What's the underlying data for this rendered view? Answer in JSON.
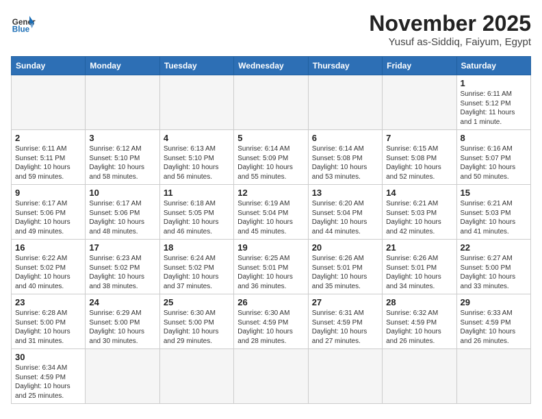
{
  "header": {
    "logo_general": "General",
    "logo_blue": "Blue",
    "month_title": "November 2025",
    "location": "Yusuf as-Siddiq, Faiyum, Egypt"
  },
  "weekdays": [
    "Sunday",
    "Monday",
    "Tuesday",
    "Wednesday",
    "Thursday",
    "Friday",
    "Saturday"
  ],
  "days": [
    {
      "num": "",
      "info": "",
      "empty": true
    },
    {
      "num": "",
      "info": "",
      "empty": true
    },
    {
      "num": "",
      "info": "",
      "empty": true
    },
    {
      "num": "",
      "info": "",
      "empty": true
    },
    {
      "num": "",
      "info": "",
      "empty": true
    },
    {
      "num": "",
      "info": "",
      "empty": true
    },
    {
      "num": "1",
      "info": "Sunrise: 6:11 AM\nSunset: 5:12 PM\nDaylight: 11 hours\nand 1 minute.",
      "empty": false
    },
    {
      "num": "2",
      "info": "Sunrise: 6:11 AM\nSunset: 5:11 PM\nDaylight: 10 hours\nand 59 minutes.",
      "empty": false
    },
    {
      "num": "3",
      "info": "Sunrise: 6:12 AM\nSunset: 5:10 PM\nDaylight: 10 hours\nand 58 minutes.",
      "empty": false
    },
    {
      "num": "4",
      "info": "Sunrise: 6:13 AM\nSunset: 5:10 PM\nDaylight: 10 hours\nand 56 minutes.",
      "empty": false
    },
    {
      "num": "5",
      "info": "Sunrise: 6:14 AM\nSunset: 5:09 PM\nDaylight: 10 hours\nand 55 minutes.",
      "empty": false
    },
    {
      "num": "6",
      "info": "Sunrise: 6:14 AM\nSunset: 5:08 PM\nDaylight: 10 hours\nand 53 minutes.",
      "empty": false
    },
    {
      "num": "7",
      "info": "Sunrise: 6:15 AM\nSunset: 5:08 PM\nDaylight: 10 hours\nand 52 minutes.",
      "empty": false
    },
    {
      "num": "8",
      "info": "Sunrise: 6:16 AM\nSunset: 5:07 PM\nDaylight: 10 hours\nand 50 minutes.",
      "empty": false
    },
    {
      "num": "9",
      "info": "Sunrise: 6:17 AM\nSunset: 5:06 PM\nDaylight: 10 hours\nand 49 minutes.",
      "empty": false
    },
    {
      "num": "10",
      "info": "Sunrise: 6:17 AM\nSunset: 5:06 PM\nDaylight: 10 hours\nand 48 minutes.",
      "empty": false
    },
    {
      "num": "11",
      "info": "Sunrise: 6:18 AM\nSunset: 5:05 PM\nDaylight: 10 hours\nand 46 minutes.",
      "empty": false
    },
    {
      "num": "12",
      "info": "Sunrise: 6:19 AM\nSunset: 5:04 PM\nDaylight: 10 hours\nand 45 minutes.",
      "empty": false
    },
    {
      "num": "13",
      "info": "Sunrise: 6:20 AM\nSunset: 5:04 PM\nDaylight: 10 hours\nand 44 minutes.",
      "empty": false
    },
    {
      "num": "14",
      "info": "Sunrise: 6:21 AM\nSunset: 5:03 PM\nDaylight: 10 hours\nand 42 minutes.",
      "empty": false
    },
    {
      "num": "15",
      "info": "Sunrise: 6:21 AM\nSunset: 5:03 PM\nDaylight: 10 hours\nand 41 minutes.",
      "empty": false
    },
    {
      "num": "16",
      "info": "Sunrise: 6:22 AM\nSunset: 5:02 PM\nDaylight: 10 hours\nand 40 minutes.",
      "empty": false
    },
    {
      "num": "17",
      "info": "Sunrise: 6:23 AM\nSunset: 5:02 PM\nDaylight: 10 hours\nand 38 minutes.",
      "empty": false
    },
    {
      "num": "18",
      "info": "Sunrise: 6:24 AM\nSunset: 5:02 PM\nDaylight: 10 hours\nand 37 minutes.",
      "empty": false
    },
    {
      "num": "19",
      "info": "Sunrise: 6:25 AM\nSunset: 5:01 PM\nDaylight: 10 hours\nand 36 minutes.",
      "empty": false
    },
    {
      "num": "20",
      "info": "Sunrise: 6:26 AM\nSunset: 5:01 PM\nDaylight: 10 hours\nand 35 minutes.",
      "empty": false
    },
    {
      "num": "21",
      "info": "Sunrise: 6:26 AM\nSunset: 5:01 PM\nDaylight: 10 hours\nand 34 minutes.",
      "empty": false
    },
    {
      "num": "22",
      "info": "Sunrise: 6:27 AM\nSunset: 5:00 PM\nDaylight: 10 hours\nand 33 minutes.",
      "empty": false
    },
    {
      "num": "23",
      "info": "Sunrise: 6:28 AM\nSunset: 5:00 PM\nDaylight: 10 hours\nand 31 minutes.",
      "empty": false
    },
    {
      "num": "24",
      "info": "Sunrise: 6:29 AM\nSunset: 5:00 PM\nDaylight: 10 hours\nand 30 minutes.",
      "empty": false
    },
    {
      "num": "25",
      "info": "Sunrise: 6:30 AM\nSunset: 5:00 PM\nDaylight: 10 hours\nand 29 minutes.",
      "empty": false
    },
    {
      "num": "26",
      "info": "Sunrise: 6:30 AM\nSunset: 4:59 PM\nDaylight: 10 hours\nand 28 minutes.",
      "empty": false
    },
    {
      "num": "27",
      "info": "Sunrise: 6:31 AM\nSunset: 4:59 PM\nDaylight: 10 hours\nand 27 minutes.",
      "empty": false
    },
    {
      "num": "28",
      "info": "Sunrise: 6:32 AM\nSunset: 4:59 PM\nDaylight: 10 hours\nand 26 minutes.",
      "empty": false
    },
    {
      "num": "29",
      "info": "Sunrise: 6:33 AM\nSunset: 4:59 PM\nDaylight: 10 hours\nand 26 minutes.",
      "empty": false
    },
    {
      "num": "30",
      "info": "Sunrise: 6:34 AM\nSunset: 4:59 PM\nDaylight: 10 hours\nand 25 minutes.",
      "empty": false
    },
    {
      "num": "",
      "info": "",
      "empty": true
    },
    {
      "num": "",
      "info": "",
      "empty": true
    },
    {
      "num": "",
      "info": "",
      "empty": true
    },
    {
      "num": "",
      "info": "",
      "empty": true
    },
    {
      "num": "",
      "info": "",
      "empty": true
    },
    {
      "num": "",
      "info": "",
      "empty": true
    }
  ]
}
